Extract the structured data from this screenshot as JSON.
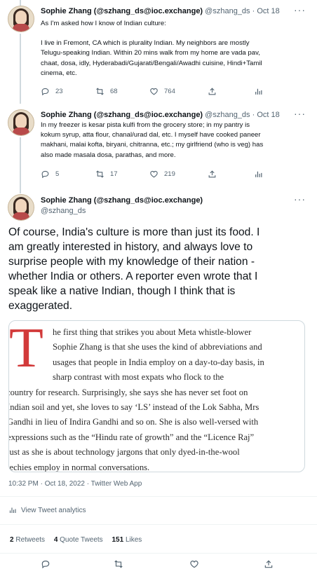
{
  "tweets": [
    {
      "name": "Sophie Zhang (@szhang_ds@ioc.exchange)",
      "handle": "@szhang_ds",
      "date": "· Oct 18",
      "lines": [
        "As I'm asked how I know of Indian culture:",
        "",
        "I live in Fremont, CA which is plurality Indian. My neighbors are mostly",
        "Telugu-speaking Indian. Within 20 mins walk from my home are vada pav,",
        "chaat, dosa, idly, Hyderabadi/Gujarati/Bengali/Awadhi cuisine, Hindi+Tamil",
        "cinema, etc."
      ],
      "replies": "23",
      "retweets": "68",
      "likes": "764"
    },
    {
      "name": "Sophie Zhang (@szhang_ds@ioc.exchange)",
      "handle": "@szhang_ds",
      "date": "· Oct 18",
      "lines": [
        "In my freezer is kesar pista kulfi from the grocery store; in my pantry is",
        "kokum syrup, atta flour, chanal/urad dal, etc. I myself have cooked paneer",
        "makhani, malai kofta, biryani, chitranna, etc.; my girlfriend (who is veg) has",
        "also made masala dosa, parathas, and more."
      ],
      "replies": "5",
      "retweets": "17",
      "likes": "219"
    }
  ],
  "main": {
    "name": "Sophie Zhang (@szhang_ds@ioc.exchange)",
    "handle": "@szhang_ds",
    "lines": [
      "Of course, India's culture is more than just its food. I",
      "am greatly interested in history, and always love to",
      "surprise people with my knowledge of their nation -",
      "whether India or others. A reporter even wrote that I",
      "speak like a native Indian, though I think that is",
      "exaggerated."
    ],
    "quote_dropcap": "T",
    "quote_lines": [
      "he first thing that strikes you about Meta whistle-blower",
      "Sophie Zhang is that she uses the kind of abbreviations and",
      "usages that people in India employ on a day-to-day basis, in",
      "sharp contrast with most expats who flock to the",
      "country for research. Surprisingly, she says she has never set foot on",
      "Indian soil and yet, she loves to say ‘LS’ instead of the Lok Sabha, Mrs",
      "Gandhi in lieu of Indira Gandhi and so on. She is also well-versed with",
      "expressions such as the “Hindu rate of growth” and the “Licence Raj”",
      "just as she is about technology jargons that only dyed-in-the-wool",
      "techies employ in normal conversations."
    ],
    "timestamp": "10:32 PM · Oct 18, 2022 · Twitter Web App",
    "analytics_label": "View Tweet analytics",
    "retweets_count": "2",
    "retweets_label": "Retweets",
    "quotes_count": "4",
    "quotes_label": "Quote Tweets",
    "likes_count": "151",
    "likes_label": "Likes"
  },
  "icons": [
    "more-icon",
    "reply-icon",
    "retweet-icon",
    "like-icon",
    "share-icon",
    "analytics-icon"
  ],
  "colors": {
    "dropcap": "#d23a3a",
    "secondary": "#536471"
  }
}
